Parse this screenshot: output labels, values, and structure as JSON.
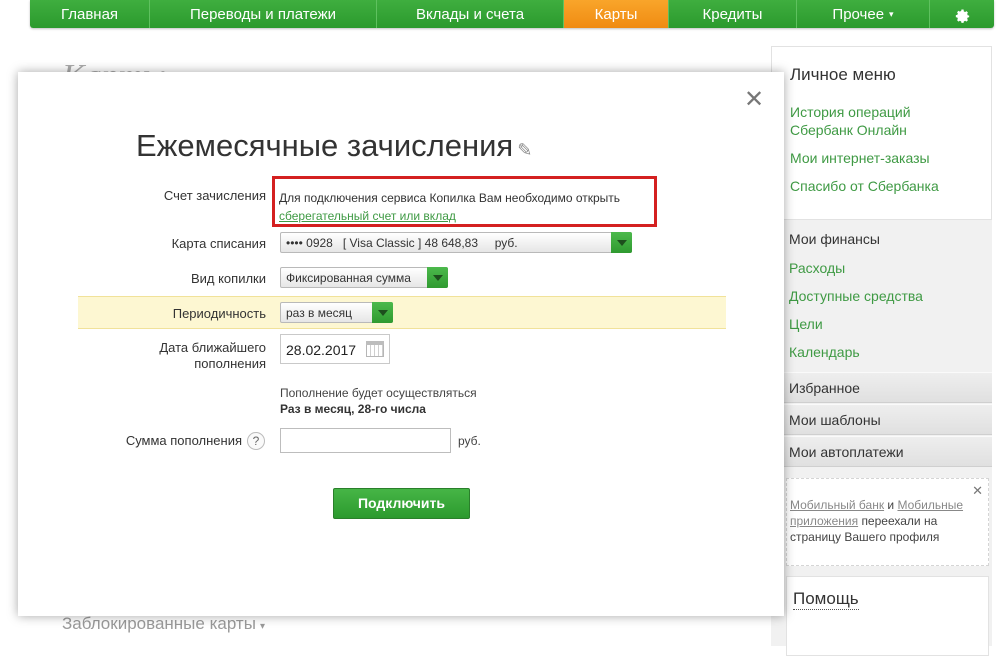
{
  "nav": {
    "items": [
      {
        "label": "Главная"
      },
      {
        "label": "Переводы и платежи"
      },
      {
        "label": "Вклады и счета"
      },
      {
        "label": "Карты"
      },
      {
        "label": "Кредиты"
      },
      {
        "label": "Прочее"
      }
    ],
    "more_caret": "▾",
    "settings_icon": "gear-icon",
    "active_color": "#f39a1c",
    "brand_color": "#32a332"
  },
  "background": {
    "page_title": "Карты",
    "blocked_cards": "Заблокированные карты",
    "blocked_caret": "▾"
  },
  "sidebar": {
    "personal_menu_title": "Личное меню",
    "links": [
      "История операций Сбербанк Онлайн",
      "Мои интернет-заказы",
      "Спасибо от Сбербанка"
    ],
    "finances_title": "Мои финансы",
    "finance_links": [
      "Расходы",
      "Доступные средства",
      "Цели",
      "Календарь"
    ],
    "rows": [
      "Избранное",
      "Мои шаблоны",
      "Мои автоплатежи"
    ],
    "notice": {
      "link1": "Мобильный банк",
      "and": "и",
      "link2": "Мобильные приложения",
      "text": "переехали на страницу Вашего профиля"
    },
    "help_title": "Помощь"
  },
  "dialog": {
    "title": "Ежемесячные зачисления",
    "close_glyph": "✕",
    "edit_glyph": "✎",
    "account_label": "Счет зачисления",
    "account_message": "Для подключения сервиса Копилка Вам необходимо открыть",
    "account_link": "сберегательный счет или вклад",
    "card_label": "Карта списания",
    "card_value": "•••• 0928   [ Visa Classic ] 48 648,83     руб.",
    "type_label": "Вид копилки",
    "type_value": "Фиксированная сумма",
    "period_label": "Периодичность",
    "period_value": "раз в месяц",
    "date_label_line1": "Дата ближайшего",
    "date_label_line2": "пополнения",
    "date_value": "28.02.2017",
    "info_line1": "Пополнение будет осуществляться",
    "info_line2": "Раз в месяц, 28-го числа",
    "amount_label": "Сумма пополнения",
    "amount_help": "?",
    "amount_value": "",
    "currency": "руб.",
    "submit_label": "Подключить",
    "highlight_color": "#d42020"
  }
}
